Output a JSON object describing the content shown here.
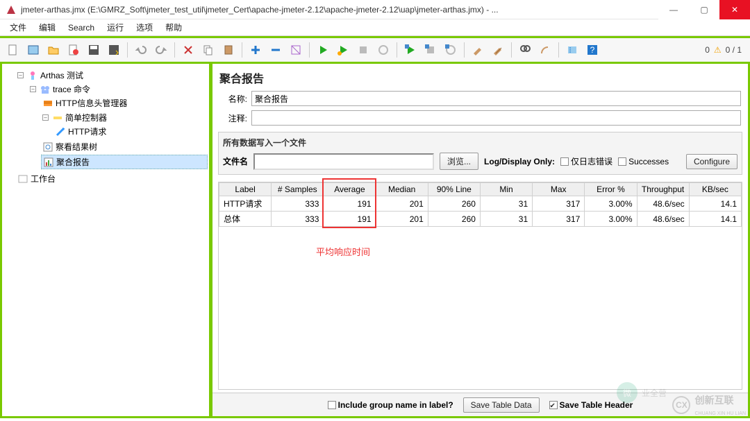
{
  "window": {
    "title": "jmeter-arthas.jmx (E:\\GMRZ_Soft\\jmeter_test_util\\jmeter_Cert\\apache-jmeter-2.12\\apache-jmeter-2.12\\uap\\jmeter-arthas.jmx) - ..."
  },
  "menu": {
    "items": [
      "文件",
      "编辑",
      "Search",
      "运行",
      "选项",
      "帮助"
    ]
  },
  "status": {
    "left": "0",
    "warn": "⚠",
    "right": "0 / 1"
  },
  "tree": {
    "n0": "Arthas 测试",
    "n1": "trace 命令",
    "n2": "HTTP信息头管理器",
    "n3": "简单控制器",
    "n4": "HTTP请求",
    "n5": "察看结果树",
    "n6": "聚合报告",
    "n7": "工作台"
  },
  "panel": {
    "title": "聚合报告",
    "name_label": "名称:",
    "name_value": "聚合报告",
    "comment_label": "注释:",
    "comment_value": "",
    "fs_legend": "所有数据写入一个文件",
    "file_label": "文件名",
    "file_value": "",
    "browse": "浏览...",
    "logdisplay": "Log/Display Only:",
    "err_only": "仅日志错误",
    "successes": "Successes",
    "configure": "Configure"
  },
  "table": {
    "headers": [
      "Label",
      "# Samples",
      "Average",
      "Median",
      "90% Line",
      "Min",
      "Max",
      "Error %",
      "Throughput",
      "KB/sec"
    ],
    "rows": [
      {
        "label": "HTTP请求",
        "samples": "333",
        "avg": "191",
        "median": "201",
        "p90": "260",
        "min": "31",
        "max": "317",
        "err": "3.00%",
        "tp": "48.6/sec",
        "kb": "14.1"
      },
      {
        "label": "总体",
        "samples": "333",
        "avg": "191",
        "median": "201",
        "p90": "260",
        "min": "31",
        "max": "317",
        "err": "3.00%",
        "tp": "48.6/sec",
        "kb": "14.1"
      }
    ]
  },
  "annotation": {
    "avg": "平均响应时间"
  },
  "bottom": {
    "include_group": "Include group name in label?",
    "save_table": "Save Table Data",
    "save_header": "Save Table Header"
  },
  "watermark": {
    "brand": "创新互联",
    "sub": "CHUANG XIN HU LIAN",
    "round": "业全营"
  }
}
